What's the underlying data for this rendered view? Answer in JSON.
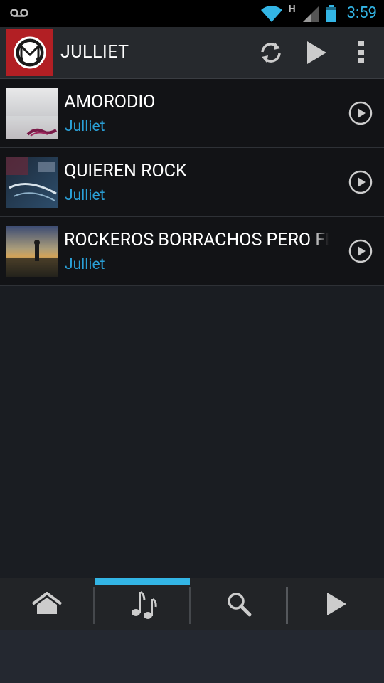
{
  "status_bar": {
    "time": "3:59",
    "network_type": "H",
    "icons": [
      "voicemail-icon",
      "wifi-icon",
      "signal-icon",
      "battery-icon"
    ]
  },
  "action_bar": {
    "title": "JULLIET",
    "actions": [
      "refresh-icon",
      "play-icon",
      "overflow-menu-icon"
    ]
  },
  "songs": [
    {
      "title": "AMORODIO",
      "artist": "Julliet"
    },
    {
      "title": "QUIEREN ROCK",
      "artist": "Julliet"
    },
    {
      "title": "ROCKEROS BORRACHOS PERO FELICES",
      "artist": "Julliet"
    }
  ],
  "tab_bar": {
    "tabs": [
      "home-icon",
      "music-note-icon",
      "search-icon",
      "play-icon"
    ],
    "selected": "music-note-icon"
  },
  "colors": {
    "accent": "#33b5e5",
    "artist_text": "#2a9fd6",
    "logo_bg": "#b21f24"
  }
}
